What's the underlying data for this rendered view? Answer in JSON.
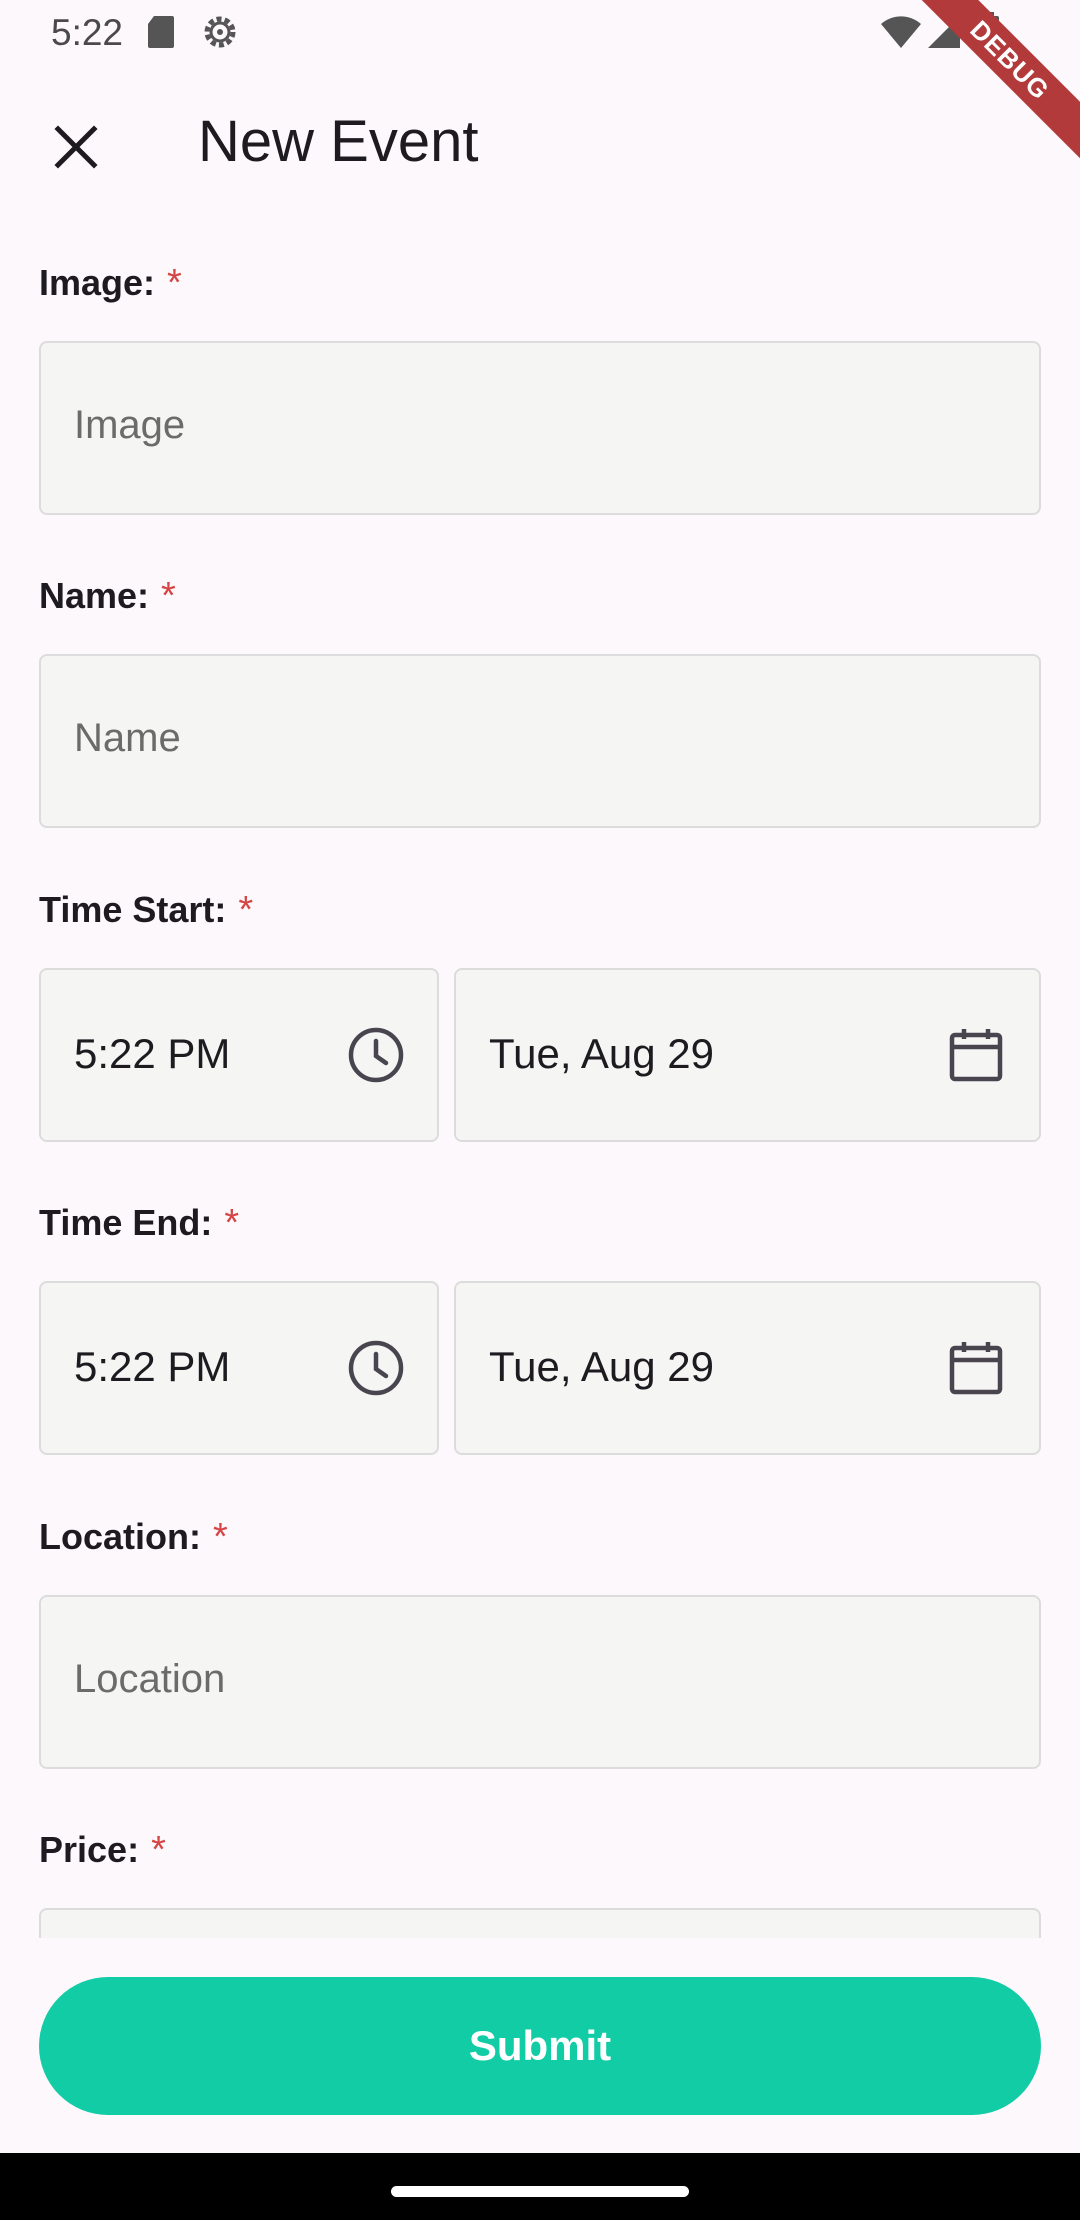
{
  "status_bar": {
    "time": "5:22",
    "icons": [
      "sd-card-icon",
      "settings-icon",
      "wifi-icon",
      "signal-icon",
      "battery-icon"
    ],
    "debug_banner": "DEBUG"
  },
  "app_bar": {
    "title": "New Event",
    "close_icon": "close-icon"
  },
  "form": {
    "required_marker": "*",
    "image": {
      "label": "Image:",
      "placeholder": "Image"
    },
    "name": {
      "label": "Name:",
      "placeholder": "Name"
    },
    "time_start": {
      "label": "Time Start:",
      "time": "5:22 PM",
      "date": "Tue, Aug 29"
    },
    "time_end": {
      "label": "Time End:",
      "time": "5:22 PM",
      "date": "Tue, Aug 29"
    },
    "location": {
      "label": "Location:",
      "placeholder": "Location"
    },
    "price": {
      "label": "Price:"
    }
  },
  "submit": {
    "label": "Submit"
  },
  "colors": {
    "accent": "#12cca6",
    "required": "#d64545",
    "background": "#fdf8fc",
    "input_fill": "#f5f5f4"
  }
}
